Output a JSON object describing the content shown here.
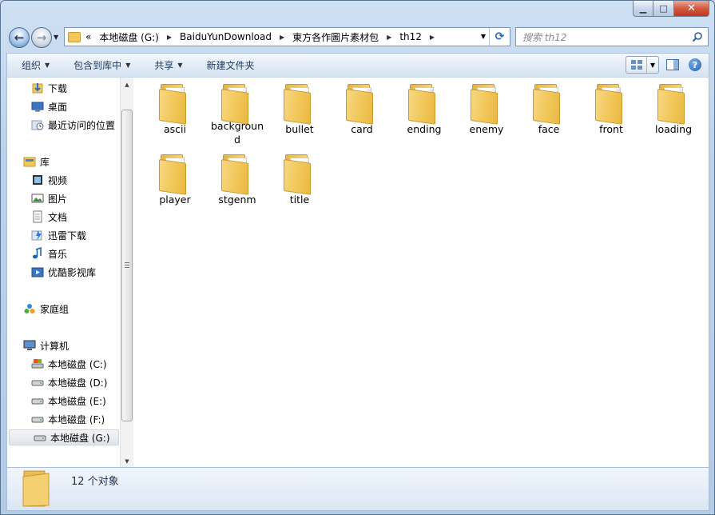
{
  "window": {
    "caption": {
      "min": "▁",
      "max": "□",
      "close": "✕"
    }
  },
  "nav": {
    "back": "←",
    "forward": "→"
  },
  "address": {
    "overflow": "«",
    "parts": [
      "本地磁盘 (G:)",
      "BaiduYunDownload",
      "東方各作圖片素材包",
      "th12"
    ]
  },
  "search": {
    "placeholder": "搜索 th12"
  },
  "toolbar": {
    "organize": "组织",
    "include_library": "包含到库中",
    "share": "共享",
    "new_folder": "新建文件夹"
  },
  "sidebar": {
    "items": [
      {
        "label": "下载",
        "icon": "download-folder-icon",
        "indent": "sub"
      },
      {
        "label": "桌面",
        "icon": "desktop-icon",
        "indent": "sub"
      },
      {
        "label": "最近访问的位置",
        "icon": "recent-places-icon",
        "indent": "sub"
      },
      {
        "label": "库",
        "icon": "libraries-icon",
        "indent": "top"
      },
      {
        "label": "视频",
        "icon": "video-library-icon",
        "indent": "sub"
      },
      {
        "label": "图片",
        "icon": "pictures-library-icon",
        "indent": "sub"
      },
      {
        "label": "文档",
        "icon": "documents-library-icon",
        "indent": "sub"
      },
      {
        "label": "迅雷下载",
        "icon": "thunder-download-icon",
        "indent": "sub"
      },
      {
        "label": "音乐",
        "icon": "music-library-icon",
        "indent": "sub"
      },
      {
        "label": "优酷影视库",
        "icon": "youku-library-icon",
        "indent": "sub"
      },
      {
        "label": "家庭组",
        "icon": "homegroup-icon",
        "indent": "top"
      },
      {
        "label": "计算机",
        "icon": "computer-icon",
        "indent": "top"
      },
      {
        "label": "本地磁盘 (C:)",
        "icon": "system-drive-icon",
        "indent": "sub"
      },
      {
        "label": "本地磁盘 (D:)",
        "icon": "drive-icon",
        "indent": "sub"
      },
      {
        "label": "本地磁盘 (E:)",
        "icon": "drive-icon",
        "indent": "sub"
      },
      {
        "label": "本地磁盘 (F:)",
        "icon": "drive-icon",
        "indent": "sub"
      },
      {
        "label": "本地磁盘 (G:)",
        "icon": "drive-icon",
        "indent": "sub",
        "selected": true
      }
    ]
  },
  "files": [
    {
      "name": "ascii",
      "thumb": "#d9a0a0"
    },
    {
      "name": "background",
      "thumb": "#8a8a8a"
    },
    {
      "name": "bullet",
      "thumb": "#a8d8c0"
    },
    {
      "name": "card",
      "thumb": "#c03060"
    },
    {
      "name": "ending",
      "thumb": "#303050"
    },
    {
      "name": "enemy",
      "thumb": "#e06060"
    },
    {
      "name": "face",
      "thumb": "#a0d0e0"
    },
    {
      "name": "front",
      "thumb": "#a02020"
    },
    {
      "name": "loading",
      "thumb": "#40a0b0"
    },
    {
      "name": "player",
      "thumb": "#e8d090"
    },
    {
      "name": "stgenm",
      "thumb": "#e8d8a0"
    },
    {
      "name": "title",
      "thumb": "#b0b0b0"
    }
  ],
  "status": {
    "count_text": "12 个对象"
  }
}
